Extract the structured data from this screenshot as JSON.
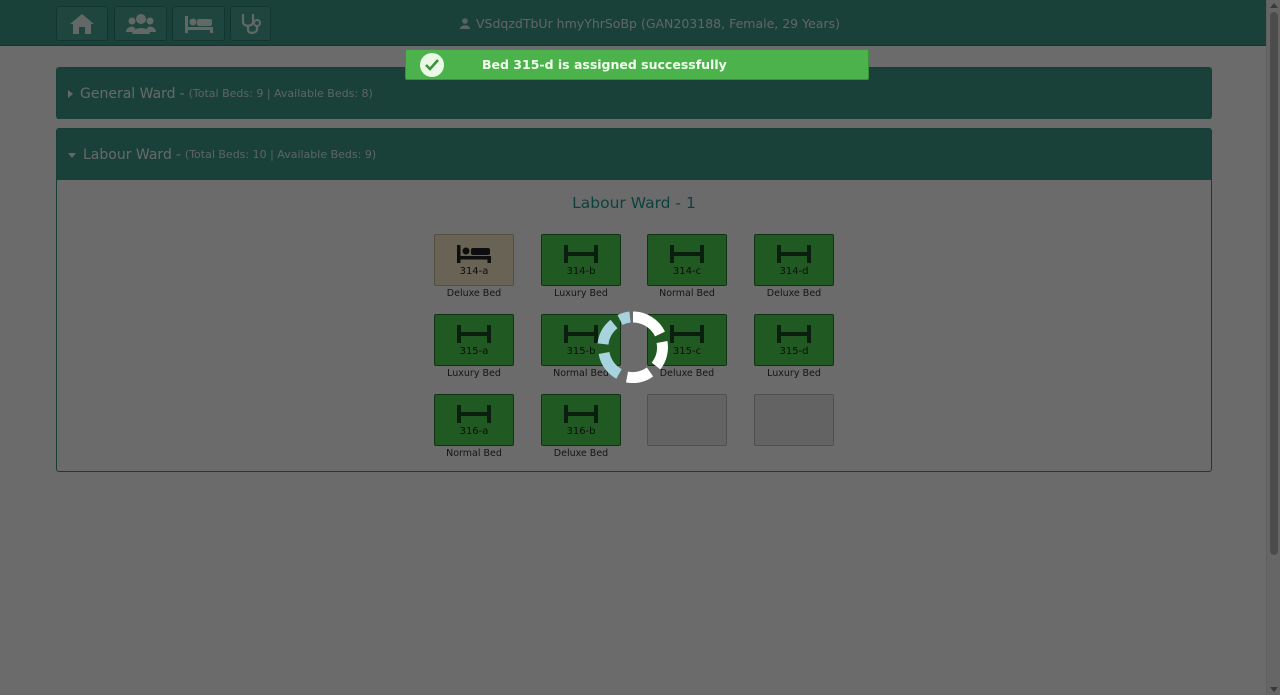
{
  "header": {
    "nav_icons": [
      "home-icon",
      "users-icon",
      "bed-icon",
      "stethoscope-icon"
    ],
    "patient_icon": "user-icon",
    "patient_text": "VSdqzdTbUr hmyYhrSoBp (GAN203188, Female, 29 Years)"
  },
  "toast": {
    "icon": "check-circle-icon",
    "message": "Bed 315-d is assigned successfully"
  },
  "wards": [
    {
      "name": "General Ward",
      "dash": "-",
      "stats": "(Total Beds: 9 | Available Beds: 8)",
      "expanded": false
    },
    {
      "name": "Labour Ward",
      "dash": "-",
      "stats": "(Total Beds: 10 | Available Beds: 9)",
      "expanded": true,
      "subtitle": "Labour Ward - 1",
      "beds": [
        {
          "number": "314-a",
          "type": "Deluxe Bed",
          "status": "occupied"
        },
        {
          "number": "314-b",
          "type": "Luxury Bed",
          "status": "available"
        },
        {
          "number": "314-c",
          "type": "Normal Bed",
          "status": "available"
        },
        {
          "number": "314-d",
          "type": "Deluxe Bed",
          "status": "available"
        },
        {
          "number": "315-a",
          "type": "Luxury Bed",
          "status": "available"
        },
        {
          "number": "315-b",
          "type": "Normal Bed",
          "status": "available"
        },
        {
          "number": "315-c",
          "type": "Deluxe Bed",
          "status": "available"
        },
        {
          "number": "315-d",
          "type": "Luxury Bed",
          "status": "available"
        },
        {
          "number": "316-a",
          "type": "Normal Bed",
          "status": "available"
        },
        {
          "number": "316-b",
          "type": "Deluxe Bed",
          "status": "available"
        },
        {
          "number": "",
          "type": "",
          "status": "empty"
        },
        {
          "number": "",
          "type": "",
          "status": "empty"
        }
      ]
    }
  ],
  "colors": {
    "header": "#3f9a8a",
    "bed_available": "#4dd550",
    "bed_occupied": "#f7edca",
    "toast": "#4cb34c",
    "subtitle": "#1f9c8e"
  },
  "loading": true
}
